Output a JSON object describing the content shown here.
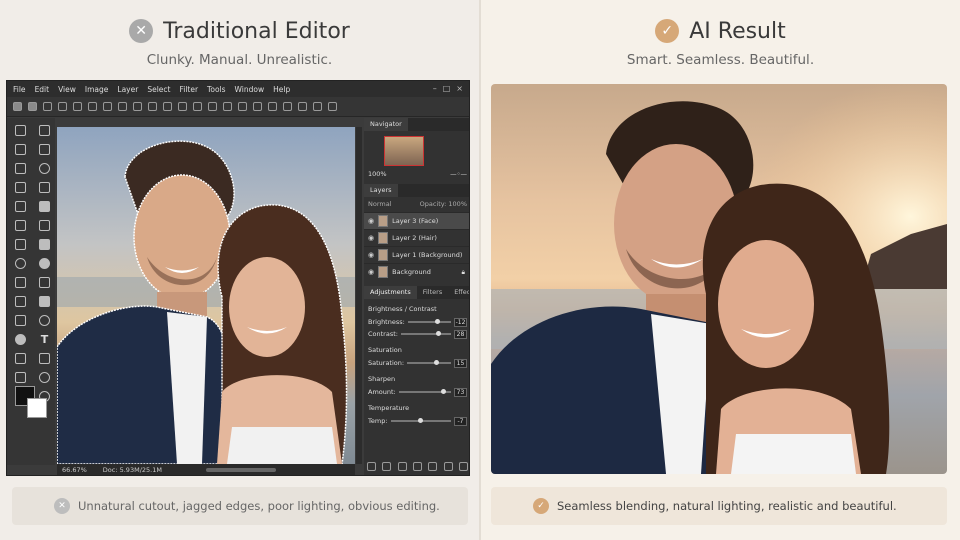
{
  "left": {
    "title": "Traditional Editor",
    "subtitle": "Clunky. Manual. Unrealistic.",
    "icon": "close-circle-icon",
    "footer": "Unnatural cutout, jagged edges, poor lighting, obvious editing."
  },
  "right": {
    "title": "AI Result",
    "subtitle": "Smart. Seamless. Beautiful.",
    "icon": "check-circle-icon",
    "footer": "Seamless blending, natural lighting, realistic and beautiful."
  },
  "editor": {
    "menu": [
      "File",
      "Edit",
      "View",
      "Image",
      "Layer",
      "Select",
      "Filter",
      "Tools",
      "Window",
      "Help"
    ],
    "status": {
      "zoom": "66.67%",
      "doc": "Doc: 5.93M/25.1M"
    },
    "navigator": {
      "tab": "Navigator",
      "zoom": "100%"
    },
    "layers": {
      "tab": "Layers",
      "blend": "Normal",
      "opacity_label": "Opacity:",
      "opacity": "100%",
      "items": [
        {
          "name": "Layer 3 (Face)"
        },
        {
          "name": "Layer 2 (Hair)"
        },
        {
          "name": "Layer 1 (Background)"
        },
        {
          "name": "Background"
        }
      ]
    },
    "adjustments": {
      "tabs": [
        "Adjustments",
        "Filters",
        "Effects"
      ],
      "groups": [
        {
          "title": "Brightness / Contrast",
          "rows": [
            {
              "label": "Brightness:",
              "value": "-12",
              "level": 0.62
            },
            {
              "label": "Contrast:",
              "value": "28",
              "level": 0.7
            }
          ]
        },
        {
          "title": "Saturation",
          "rows": [
            {
              "label": "Saturation:",
              "value": "15",
              "level": 0.62
            }
          ]
        },
        {
          "title": "Sharpen",
          "rows": [
            {
              "label": "Amount:",
              "value": "73",
              "level": 0.8
            }
          ]
        },
        {
          "title": "Temperature",
          "rows": [
            {
              "label": "Temp:",
              "value": "-7",
              "level": 0.45
            }
          ]
        }
      ]
    }
  },
  "colors": {
    "accent": "#d6a878",
    "neutral": "#a9a9a9"
  }
}
